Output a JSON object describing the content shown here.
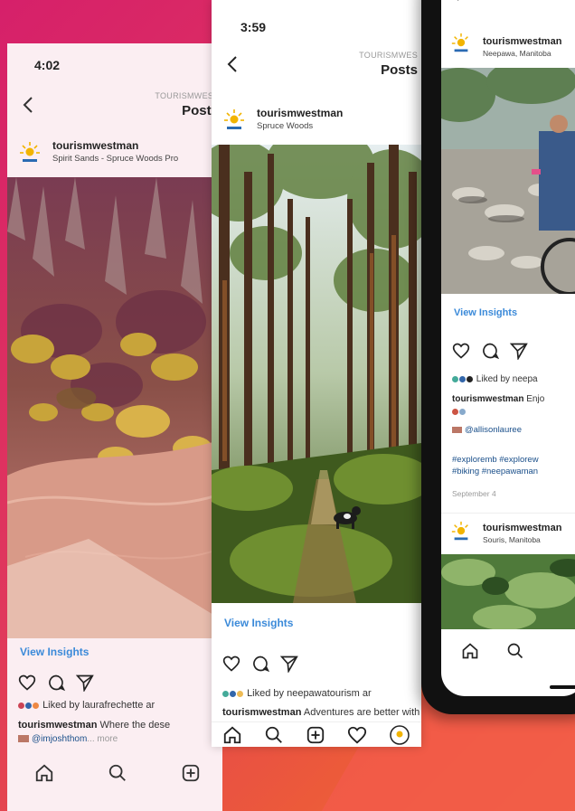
{
  "phone1": {
    "time": "4:02",
    "header_label": "TOURISMWEST",
    "header_title": "Posts",
    "account": "tourismwestman",
    "location": "Spirit Sands - Spruce Woods Pro",
    "view_insights": "View Insights",
    "liked_by": "Liked by laurafrechette ar",
    "caption_user": "tourismwestman",
    "caption_text": "Where the dese",
    "mention": "@imjoshthom",
    "more": "... more"
  },
  "phone2": {
    "time": "3:59",
    "header_label": "TOURISMWES",
    "header_title": "Posts",
    "account": "tourismwestman",
    "location": "Spruce Woods",
    "view_insights": "View Insights",
    "liked_by": "Liked by neepawatourism ar",
    "caption_user": "tourismwestman",
    "caption_text": "Adventures are better with a buddy"
  },
  "phone3": {
    "account": "tourismwestman",
    "location": "Neepawa, Manitoba",
    "view_insights": "View Insights",
    "liked_by": "Liked by neepa",
    "caption_user": "tourismwestman",
    "caption_text": "Enjo",
    "mention": "@allisonlauree",
    "hashtags_1": "#exploremb #explorew",
    "hashtags_2": "#biking #neepawaman",
    "date": "September 4",
    "account2": "tourismwestman",
    "location2": "Souris, Manitoba"
  },
  "colors": {
    "link_blue": "#3b8ad9",
    "background_start": "#d6206a",
    "background_end": "#f0703a"
  },
  "icons": [
    "home-icon",
    "search-icon",
    "add-icon",
    "heart-icon",
    "profile-icon",
    "comment-icon",
    "share-icon",
    "back-icon"
  ]
}
